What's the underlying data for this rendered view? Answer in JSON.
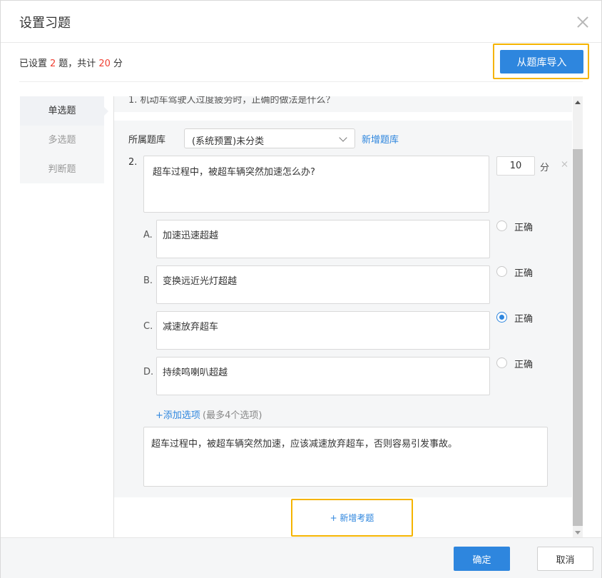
{
  "dialog": {
    "title": "设置习题"
  },
  "summary": {
    "prefix": "已设置",
    "count": "2",
    "middle": "题，共计",
    "score": "20",
    "suffix": "分"
  },
  "toolbar": {
    "import_label": "从题库导入"
  },
  "question_types": [
    {
      "label": "单选题",
      "active": true
    },
    {
      "label": "多选题",
      "active": false
    },
    {
      "label": "判断题",
      "active": false
    }
  ],
  "previous_question": {
    "text": "1.    机动车驾驶人过度疲劳时，正确的做法是什么？"
  },
  "question": {
    "bank_label": "所属题库",
    "bank_value": "(系统预置)未分类",
    "add_bank_label": "新增题库",
    "number": "2.",
    "text": "超车过程中，被超车辆突然加速怎么办?",
    "score": "10",
    "score_unit": "分",
    "options": [
      {
        "letter": "A.",
        "text": "加速迅速超越",
        "correct_label": "正确",
        "checked": false
      },
      {
        "letter": "B.",
        "text": "变换远近光灯超越",
        "correct_label": "正确",
        "checked": false
      },
      {
        "letter": "C.",
        "text": "减速放弃超车",
        "correct_label": "正确",
        "checked": true
      },
      {
        "letter": "D.",
        "text": "持续鸣喇叭超越",
        "correct_label": "正确",
        "checked": false
      }
    ],
    "add_option_label": "+添加选项",
    "add_option_hint": "(最多4个选项)",
    "explanation": "超车过程中，被超车辆突然加速，应该减速放弃超车，否则容易引发事故。"
  },
  "add_question_label": "+ 新增考题",
  "footer": {
    "ok_label": "确定",
    "cancel_label": "取消"
  },
  "colors": {
    "accent": "#2e86de",
    "highlight": "#f5b400",
    "number_red": "#f04134"
  }
}
